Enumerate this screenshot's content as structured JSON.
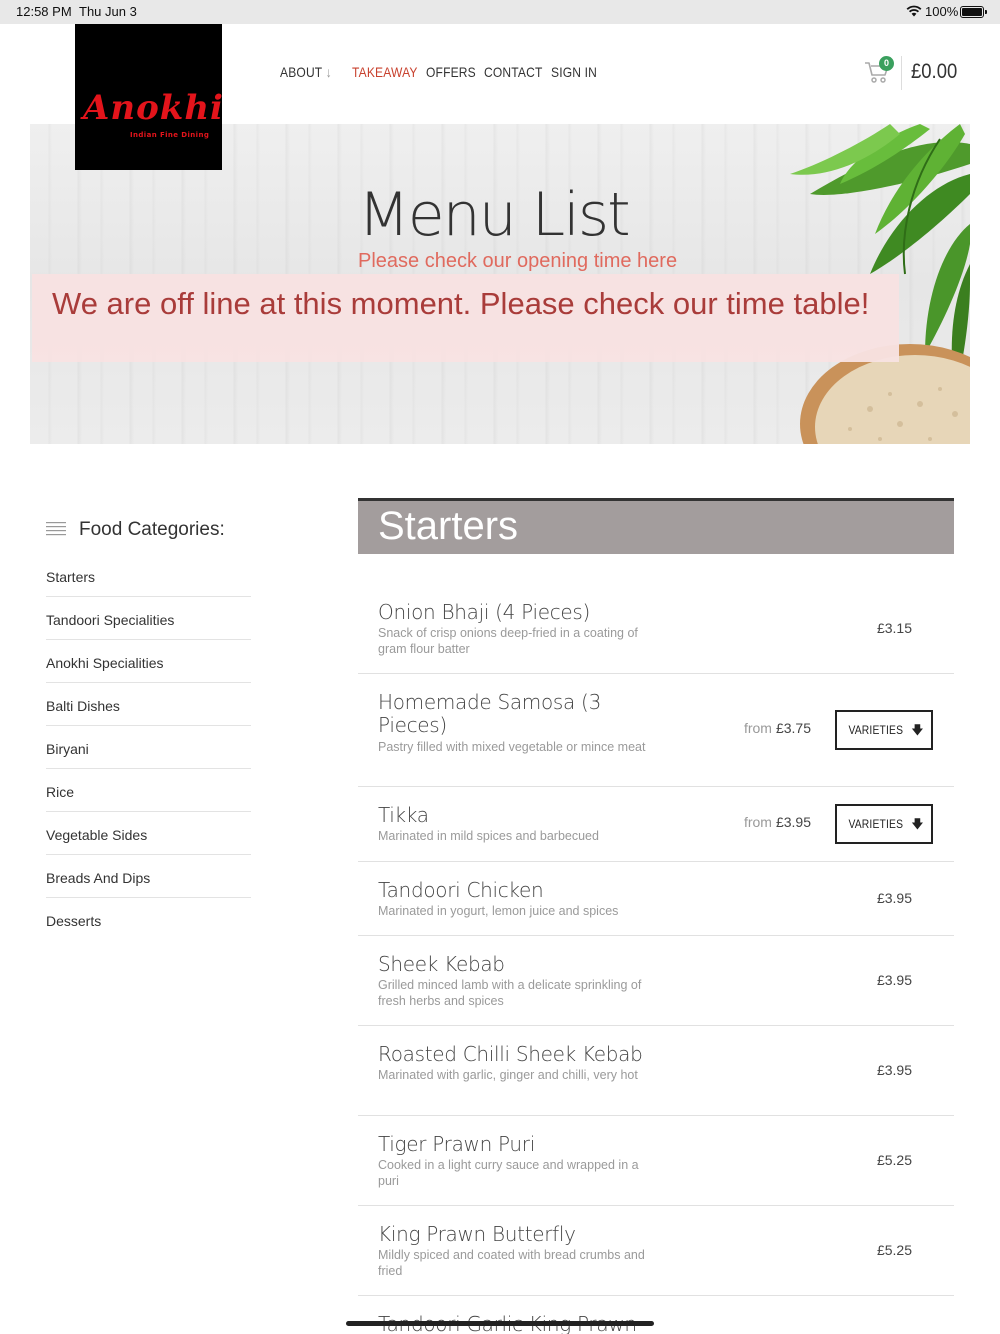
{
  "status_bar": {
    "time": "12:58 PM",
    "date": "Thu Jun 3",
    "battery": "100%"
  },
  "logo": {
    "script": "Anokhi",
    "sub": "Indian Fine Dining"
  },
  "nav": {
    "items": [
      {
        "label": "ABOUT",
        "arrow": "↓"
      },
      {
        "label": "TAKEAWAY"
      },
      {
        "label": "OFFERS"
      },
      {
        "label": "CONTACT"
      },
      {
        "label": "SIGN IN"
      }
    ]
  },
  "cart": {
    "count": "0",
    "total": "£0.00"
  },
  "hero": {
    "title": "Menu List",
    "subtitle": "Please check our opening time here",
    "offline_message": "We are off line at this moment. Please check our time table!"
  },
  "sidebar": {
    "title": "Food Categories:",
    "categories": [
      "Starters",
      "Tandoori Specialities",
      "Anokhi Specialities",
      "Balti Dishes",
      "Biryani",
      "Rice",
      "Vegetable Sides",
      "Breads And Dips",
      "Desserts"
    ]
  },
  "section": {
    "title": "Starters"
  },
  "menu": {
    "from_label": "from",
    "varieties_label": "VARIETIES",
    "items": [
      {
        "name": "Onion Bhaji (4 Pieces)",
        "desc": "Snack of crisp onions deep-fried in a coating of gram flour batter",
        "price": "£3.15"
      },
      {
        "name": "Homemade Samosa (3 Pieces)",
        "desc": "Pastry filled with mixed vegetable or mince meat",
        "price": "£3.75"
      },
      {
        "name": "Tikka",
        "desc": "Marinated in mild spices and barbecued",
        "price": "£3.95"
      },
      {
        "name": "Tandoori Chicken",
        "desc": "Marinated in yogurt, lemon juice and spices",
        "price": "£3.95"
      },
      {
        "name": "Sheek Kebab",
        "desc": "Grilled minced lamb with a delicate sprinkling of fresh herbs and spices",
        "price": "£3.95"
      },
      {
        "name": "Roasted Chilli Sheek Kebab",
        "desc": "Marinated with garlic, ginger and chilli, very hot",
        "price": "£3.95"
      },
      {
        "name": "Tiger Prawn Puri",
        "desc": "Cooked in a light curry sauce and wrapped in a puri",
        "price": "£5.25"
      },
      {
        "name": "King Prawn Butterfly",
        "desc": "Mildly spiced and coated with bread crumbs and fried",
        "price": "£5.25"
      },
      {
        "name": "Tandoori Garlic King Prawn"
      }
    ]
  },
  "colors": {
    "accent": "#c8412e",
    "badge": "#3aa05e",
    "header_bg": "#a39d9d",
    "logo_red": "#e3141b"
  }
}
